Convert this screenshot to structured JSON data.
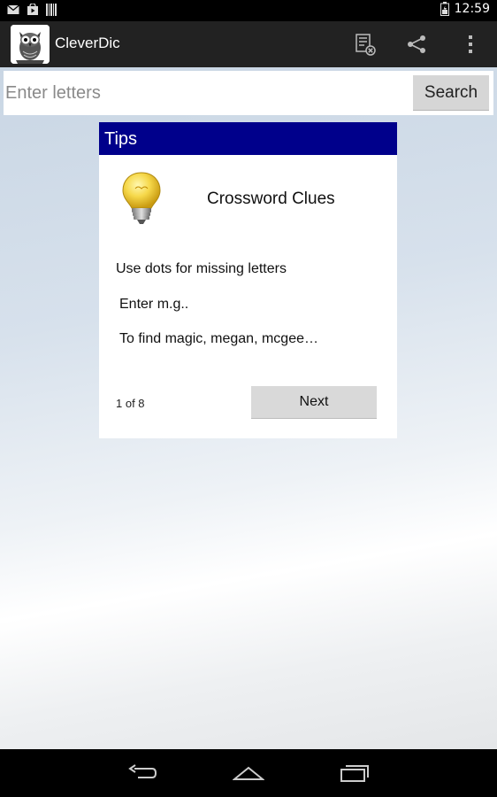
{
  "status_bar": {
    "time": "12:59",
    "icons_left": [
      "mail-icon",
      "play-store-icon",
      "barcode-icon"
    ],
    "icons_right": [
      "battery-icon"
    ]
  },
  "action_bar": {
    "app_title": "CleverDic",
    "app_icon": "owl-logo-icon",
    "actions": [
      "clear-list-icon",
      "share-icon",
      "overflow-menu-icon"
    ]
  },
  "search": {
    "placeholder": "Enter letters",
    "value": "",
    "button_label": "Search"
  },
  "tips_dialog": {
    "title": "Tips",
    "icon": "light-bulb-icon",
    "tip_title": "Crossword Clues",
    "lines": [
      "Use dots for missing letters",
      "Enter m.g..",
      "To find magic, megan, mcgee…"
    ],
    "page_indicator": "1 of 8",
    "next_label": "Next"
  },
  "nav_bar": {
    "buttons": [
      "back-icon",
      "home-icon",
      "recent-apps-icon"
    ]
  },
  "colors": {
    "dialog_header": "#00008b",
    "action_bar": "#222222",
    "button_gray": "#d6d6d6"
  }
}
